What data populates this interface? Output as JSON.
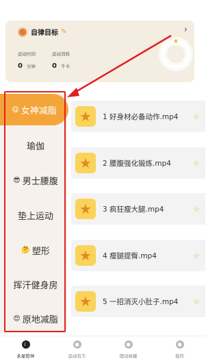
{
  "goal": {
    "title": "自律目标",
    "edit_icon": "pencil-icon",
    "arrow": "›",
    "time_label": "运动时间",
    "time_value": "0",
    "time_unit": "分钟",
    "calorie_label": "运动消耗",
    "calorie_value": "0",
    "calorie_unit": "千卡"
  },
  "categories": [
    {
      "label": "女神减脂",
      "emoji": "😋",
      "active": true
    },
    {
      "label": "瑜伽",
      "emoji": ""
    },
    {
      "label": "男士腰腹",
      "emoji": "😎"
    },
    {
      "label": "垫上运动",
      "emoji": ""
    },
    {
      "label": "塑形",
      "emoji": "🤔"
    },
    {
      "label": "挥汗健身房",
      "emoji": ""
    },
    {
      "label": "原地减脂",
      "emoji": "😍"
    }
  ],
  "videos": [
    {
      "title": "1 好身材必备动作.mp4"
    },
    {
      "title": "2 腰腹强化锻炼.mp4"
    },
    {
      "title": "3 疯狂瘦大腿.mp4"
    },
    {
      "title": "4 瘦腿提臀.mp4"
    },
    {
      "title": "5 一招消灭小肚子.mp4"
    }
  ],
  "nav": [
    {
      "label": "永星陪伴",
      "icon": "moon-icon",
      "active": true
    },
    {
      "label": "运动有方",
      "icon": "user-icon"
    },
    {
      "label": "理动收藏",
      "icon": "bookmark-icon"
    },
    {
      "label": "我的",
      "icon": "person-icon"
    }
  ],
  "colors": {
    "accent": "#f3a53a",
    "highlight": "#e02020",
    "card": "#f4ede2"
  }
}
